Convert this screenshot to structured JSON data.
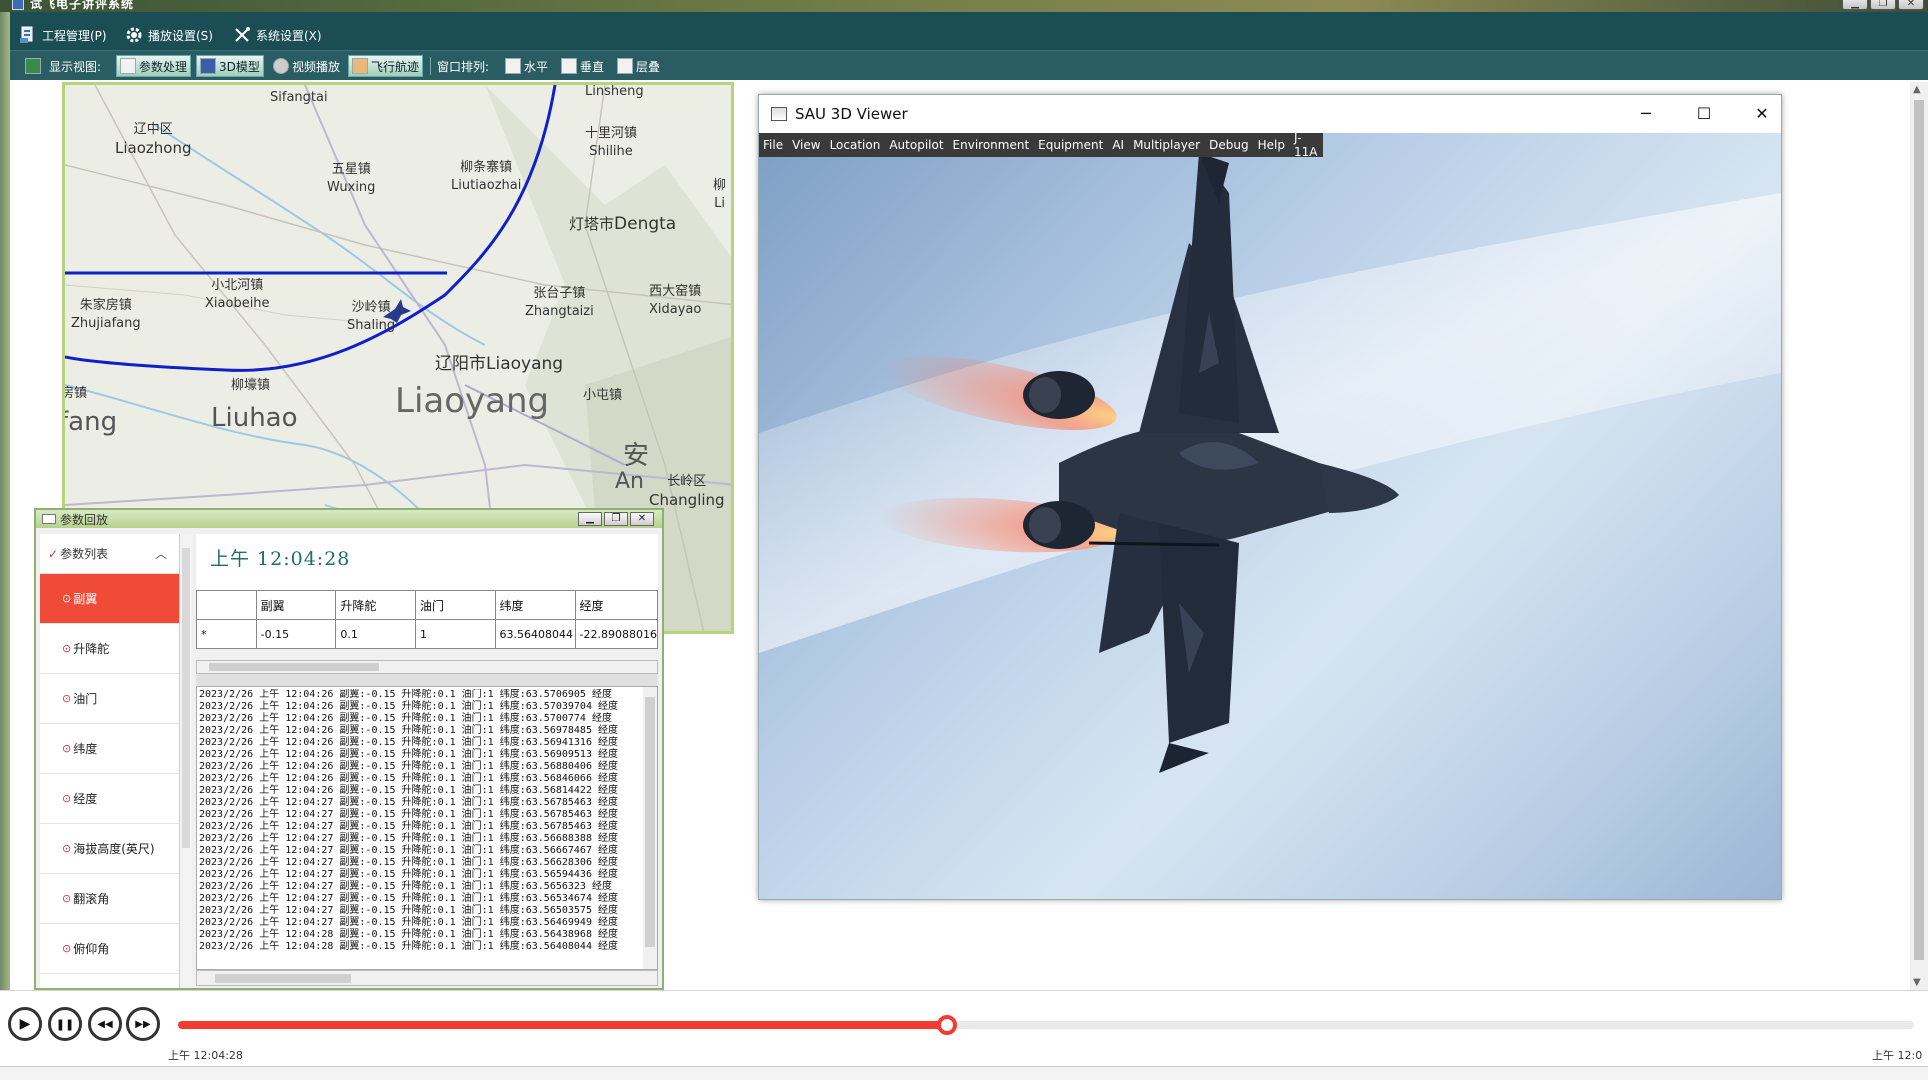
{
  "app": {
    "title": "试飞电子讲评系统",
    "window_controls": [
      "▁",
      "❐",
      "✕"
    ]
  },
  "menubar": {
    "items": [
      {
        "label": "工程管理(P)",
        "icon": "project-icon"
      },
      {
        "label": "播放设置(S)",
        "icon": "gear-icon"
      },
      {
        "label": "系统设置(X)",
        "icon": "tools-icon"
      }
    ]
  },
  "toolbar": {
    "view_label": "显示视图:",
    "views": [
      {
        "label": "参数处理",
        "active": true
      },
      {
        "label": "3D模型",
        "active": true
      },
      {
        "label": "视频播放",
        "active": false
      },
      {
        "label": "飞行航迹",
        "active": true
      }
    ],
    "arrange_label": "窗口排列:",
    "arrange": [
      "水平",
      "垂直",
      "层叠"
    ]
  },
  "map": {
    "labels": [
      {
        "zh": "",
        "en": "Sifangtai"
      },
      {
        "zh": "",
        "en": "Linsheng"
      },
      {
        "zh": "辽中区",
        "en": "Liaozhong"
      },
      {
        "zh": "十里河镇",
        "en": "Shilihe"
      },
      {
        "zh": "五星镇",
        "en": "Wuxing"
      },
      {
        "zh": "柳条寨镇",
        "en": "Liutiaozhai"
      },
      {
        "zh": "灯塔市",
        "en": "Dengta"
      },
      {
        "zh": "小北河镇",
        "en": "Xiaobeihe"
      },
      {
        "zh": "张台子镇",
        "en": "Zhangtaizi"
      },
      {
        "zh": "西大窑镇",
        "en": "Xidayao"
      },
      {
        "zh": "朱家房镇",
        "en": "Zhujiafang"
      },
      {
        "zh": "沙岭镇",
        "en": "Shaling"
      },
      {
        "zh": "辽阳市",
        "en": "Liaoyang"
      },
      {
        "zh": "柳壕镇",
        "en": ""
      },
      {
        "zh": "小屯镇",
        "en": ""
      },
      {
        "zh": "长岭区",
        "en": "Changling"
      },
      {
        "zh": "柳",
        "en": "Li"
      },
      {
        "zh": "房镇",
        "en": ""
      }
    ],
    "big_labels": [
      "fang",
      "Liuhao",
      "Liaoyang",
      "安",
      "An"
    ]
  },
  "param_window": {
    "title": "参数回放",
    "list_header": "参数列表",
    "list_items": [
      "副翼",
      "升降舵",
      "油门",
      "纬度",
      "经度",
      "海拔高度(英尺)",
      "翻滚角",
      "俯仰角"
    ],
    "selected_index": 0,
    "current_time": "上午  12:04:28",
    "table": {
      "columns": [
        "",
        "副翼",
        "升降舵",
        "油门",
        "纬度",
        "经度"
      ],
      "row": [
        "*",
        "-0.15",
        "0.1",
        "1",
        "63.56408044",
        "-22.89088016"
      ]
    },
    "log_lines": [
      "2023/2/26 上午 12:04:26 副翼:-0.15 升降舵:0.1 油门:1 纬度:63.5706905 经度",
      "2023/2/26 上午 12:04:26 副翼:-0.15 升降舵:0.1 油门:1 纬度:63.57039704 经度",
      "2023/2/26 上午 12:04:26 副翼:-0.15 升降舵:0.1 油门:1 纬度:63.5700774 经度",
      "2023/2/26 上午 12:04:26 副翼:-0.15 升降舵:0.1 油门:1 纬度:63.56978485 经度",
      "2023/2/26 上午 12:04:26 副翼:-0.15 升降舵:0.1 油门:1 纬度:63.56941316 经度",
      "2023/2/26 上午 12:04:26 副翼:-0.15 升降舵:0.1 油门:1 纬度:63.56909513 经度",
      "2023/2/26 上午 12:04:26 副翼:-0.15 升降舵:0.1 油门:1 纬度:63.56880406 经度",
      "2023/2/26 上午 12:04:26 副翼:-0.15 升降舵:0.1 油门:1 纬度:63.56846066 经度",
      "2023/2/26 上午 12:04:26 副翼:-0.15 升降舵:0.1 油门:1 纬度:63.56814422 经度",
      "2023/2/26 上午 12:04:27 副翼:-0.15 升降舵:0.1 油门:1 纬度:63.56785463 经度",
      "2023/2/26 上午 12:04:27 副翼:-0.15 升降舵:0.1 油门:1 纬度:63.56785463 经度",
      "2023/2/26 上午 12:04:27 副翼:-0.15 升降舵:0.1 油门:1 纬度:63.56785463 经度",
      "2023/2/26 上午 12:04:27 副翼:-0.15 升降舵:0.1 油门:1 纬度:63.56688388 经度",
      "2023/2/26 上午 12:04:27 副翼:-0.15 升降舵:0.1 油门:1 纬度:63.56667467 经度",
      "2023/2/26 上午 12:04:27 副翼:-0.15 升降舵:0.1 油门:1 纬度:63.56628306 经度",
      "2023/2/26 上午 12:04:27 副翼:-0.15 升降舵:0.1 油门:1 纬度:63.56594436 经度",
      "2023/2/26 上午 12:04:27 副翼:-0.15 升降舵:0.1 油门:1 纬度:63.5656323 经度",
      "2023/2/26 上午 12:04:27 副翼:-0.15 升降舵:0.1 油门:1 纬度:63.56534674 经度",
      "2023/2/26 上午 12:04:27 副翼:-0.15 升降舵:0.1 油门:1 纬度:63.56503575 经度",
      "2023/2/26 上午 12:04:27 副翼:-0.15 升降舵:0.1 油门:1 纬度:63.56469949 经度",
      "2023/2/26 上午 12:04:28 副翼:-0.15 升降舵:0.1 油门:1 纬度:63.56438968 经度",
      "2023/2/26 上午 12:04:28 副翼:-0.15 升降舵:0.1 油门:1 纬度:63.56408044 经度"
    ]
  },
  "viewer": {
    "title": "SAU 3D Viewer",
    "menu": [
      "File",
      "View",
      "Location",
      "Autopilot",
      "Environment",
      "Equipment",
      "AI",
      "Multiplayer",
      "Debug",
      "Help",
      "J-11A"
    ],
    "controls": [
      "─",
      "☐",
      "✕"
    ]
  },
  "player": {
    "buttons": [
      {
        "name": "play-button",
        "glyph": "▶"
      },
      {
        "name": "pause-button",
        "glyph": "❚❚"
      },
      {
        "name": "rewind-button",
        "glyph": "◀◀"
      },
      {
        "name": "forward-button",
        "glyph": "▶▶"
      }
    ],
    "progress": 0.443,
    "current_time": "上午  12:04:28",
    "end_time": "上午  12:0",
    "accent_color": "#f23c32"
  },
  "colors": {
    "menubar": "#1b4d55",
    "toolbar": "#2a5d63",
    "route": "#1020c8",
    "selected_item": "#f04b38"
  }
}
